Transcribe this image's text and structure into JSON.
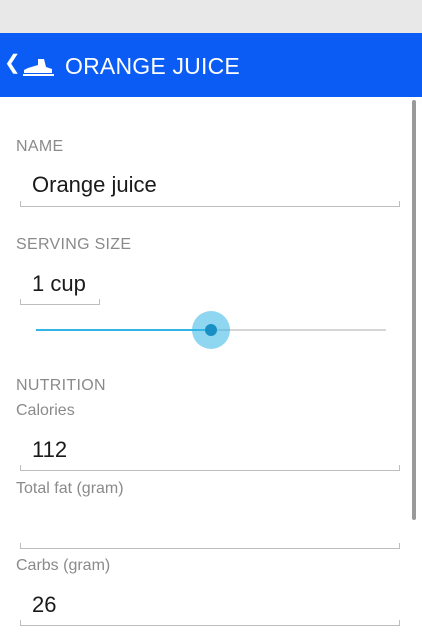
{
  "action_bar": {
    "title": "ORANGE JUICE",
    "back_icon": "chevron-left-icon",
    "app_icon": "shoe-icon",
    "color": "#0a5cf5"
  },
  "name": {
    "label": "NAME",
    "value": "Orange juice"
  },
  "serving": {
    "label": "SERVING SIZE",
    "value": "1 cup",
    "slider_fraction": 0.5,
    "slider_color": "#33b5e5"
  },
  "nutrition": {
    "label": "NUTRITION",
    "calories_label": "Calories",
    "calories_value": "112",
    "fat_label": "Total fat (gram)",
    "fat_value": "",
    "carbs_label": "Carbs (gram)",
    "carbs_value": "26"
  }
}
